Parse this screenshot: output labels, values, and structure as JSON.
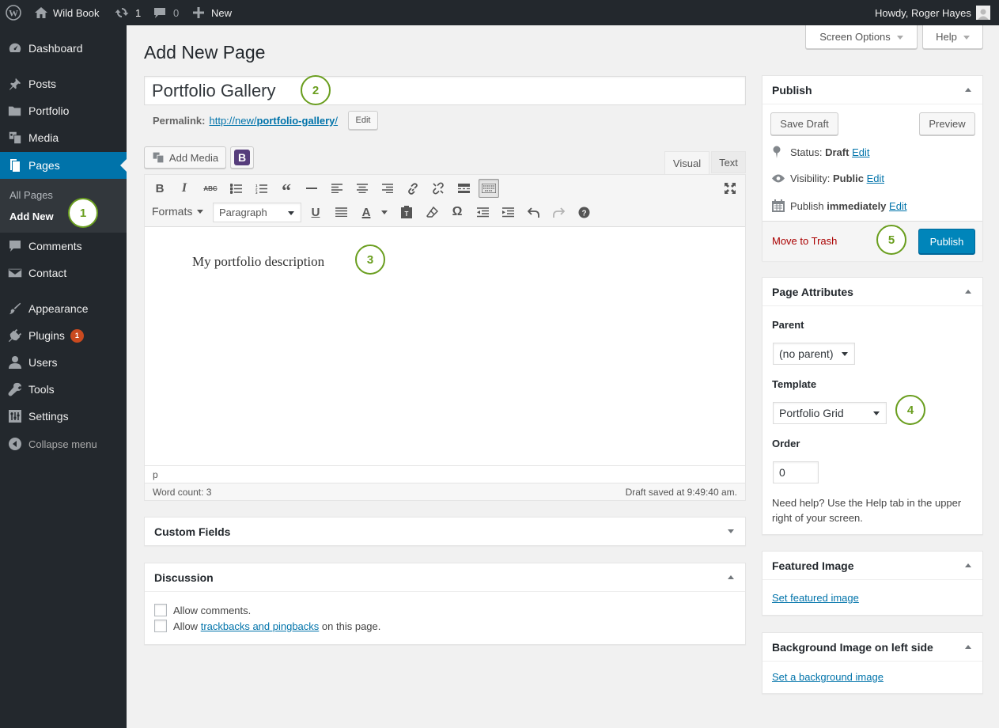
{
  "adminbar": {
    "site_name": "Wild Book",
    "updates_count": "1",
    "comments_count": "0",
    "new_label": "New",
    "howdy": "Howdy, Roger Hayes"
  },
  "sidebar": {
    "items": [
      {
        "label": "Dashboard"
      },
      {
        "label": "Posts"
      },
      {
        "label": "Portfolio"
      },
      {
        "label": "Media"
      },
      {
        "label": "Pages"
      },
      {
        "label": "Comments"
      },
      {
        "label": "Contact"
      },
      {
        "label": "Appearance"
      },
      {
        "label": "Plugins"
      },
      {
        "label": "Users"
      },
      {
        "label": "Tools"
      },
      {
        "label": "Settings"
      },
      {
        "label": "Collapse menu"
      }
    ],
    "plugins_badge": "1",
    "submenu": [
      {
        "label": "All Pages"
      },
      {
        "label": "Add New"
      }
    ]
  },
  "header": {
    "screen_options": "Screen Options",
    "help": "Help",
    "page_title": "Add New Page"
  },
  "editor": {
    "title_value": "Portfolio Gallery",
    "permalink_label": "Permalink:",
    "permalink_base": "http://new/",
    "permalink_slug": "portfolio-gallery",
    "permalink_trail": "/",
    "permalink_edit": "Edit",
    "add_media": "Add Media",
    "bootstrap_label": "B",
    "tab_visual": "Visual",
    "tab_text": "Text",
    "formats": "Formats",
    "paragraph_select": "Paragraph",
    "content": "My portfolio description",
    "path": "p",
    "word_count": "Word count: 3",
    "draft_saved": "Draft saved at 9:49:40 am."
  },
  "custom_fields": {
    "title": "Custom Fields"
  },
  "discussion": {
    "title": "Discussion",
    "allow_comments": "Allow comments.",
    "allow_prefix": "Allow",
    "trackbacks_link": "trackbacks and pingbacks",
    "allow_suffix": "on this page."
  },
  "publish": {
    "title": "Publish",
    "save_draft": "Save Draft",
    "preview": "Preview",
    "status_label": "Status:",
    "status_value": "Draft",
    "visibility_label": "Visibility:",
    "visibility_value": "Public",
    "publish_label": "Publish",
    "publish_value": "immediately",
    "edit": "Edit",
    "move_to_trash": "Move to Trash",
    "publish_button": "Publish"
  },
  "page_attributes": {
    "title": "Page Attributes",
    "parent_label": "Parent",
    "parent_value": "(no parent)",
    "template_label": "Template",
    "template_value": "Portfolio Grid",
    "order_label": "Order",
    "order_value": "0",
    "help_text_1": "Need help? Use the Help tab in the upper",
    "help_text_2": "right of your screen."
  },
  "featured_image": {
    "title": "Featured Image",
    "link": "Set featured image"
  },
  "background_image": {
    "title": "Background Image on left side",
    "link": "Set a background image"
  },
  "callouts": [
    "1",
    "2",
    "3",
    "4",
    "5"
  ],
  "colors": {
    "accent": "#0073aa",
    "callout": "#6a9e1f",
    "trash": "#a00",
    "adminbar": "#23282d"
  }
}
